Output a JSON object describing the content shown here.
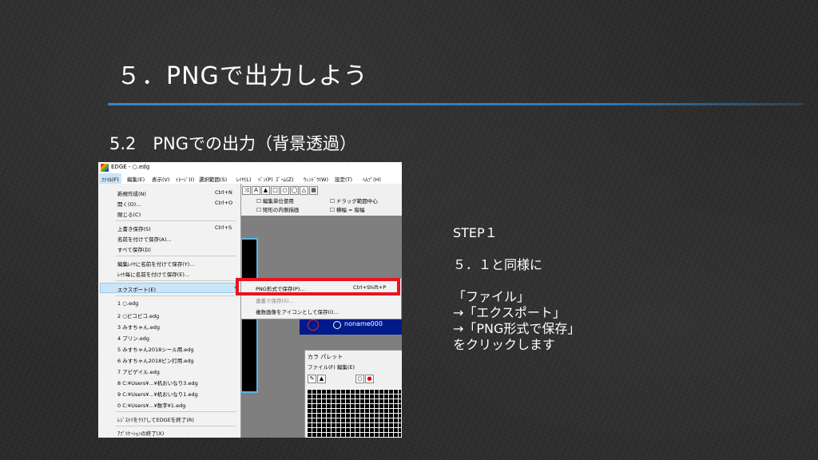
{
  "slide": {
    "title": "５．PNGで出力しよう",
    "subtitle": "5.2　PNGでの出力（背景透過）",
    "step_text": "STEP１\n\n５．１と同様に\n\n「ファイル」\n→「エクスポート」\n→「PNG形式で保存」\nをクリックします"
  },
  "app": {
    "window_title": "EDGE - ○.edg",
    "menus": [
      "ﾌｧｲﾙ(F)",
      "編集(E)",
      "表示(V)",
      "ｲﾒｰｼﾞ(I)",
      "選択範囲(S)",
      "ﾚｲﾔ(L)",
      "ﾍﾟﾝ(P)",
      "ｽﾞｰﾑ(Z)",
      "ｳｨﾝﾄﾞｳ(W)",
      "設定(T)",
      "ﾍﾙﾌﾟ(H)"
    ],
    "toolbar_checks": [
      "編集単位使用",
      "ドラッグ範囲中心",
      "矩形の内側描画",
      "横幅 = 縦幅"
    ],
    "file_menu": [
      {
        "label": "新規作成(N)",
        "key": "Ctrl+N"
      },
      {
        "label": "開く(O)...",
        "key": "Ctrl+O"
      },
      {
        "label": "閉じる(C)",
        "key": ""
      },
      {
        "label": "上書き保存(S)",
        "key": "Ctrl+S"
      },
      {
        "label": "名前を付けて保存(A)...",
        "key": ""
      },
      {
        "label": "すべて保存(D)",
        "key": ""
      },
      {
        "label": "編集ﾚｲﾔに名前を付けて保存(Y)...",
        "key": ""
      },
      {
        "label": "ﾚｲﾔ毎に名前を付けて保存(E)...",
        "key": ""
      },
      {
        "label": "エクスポート(E)",
        "key": ""
      },
      {
        "label": "1 ○.edg",
        "key": ""
      },
      {
        "label": "2 ○ピコピコ.edg",
        "key": ""
      },
      {
        "label": "3 みすちゃん.edg",
        "key": ""
      },
      {
        "label": "4 プリン.edg",
        "key": ""
      },
      {
        "label": "5 みすちゃん2018シール用.edg",
        "key": ""
      },
      {
        "label": "6 みすちゃん2018ピン打用.edg",
        "key": ""
      },
      {
        "label": "7 アピゲイル.edg",
        "key": ""
      },
      {
        "label": "8 C:¥Users¥...¥机おいなり3.edg",
        "key": ""
      },
      {
        "label": "9 C:¥Users¥...¥机おいなり1.edg",
        "key": ""
      },
      {
        "label": "0 C:¥Users¥...¥数字¥1.edg",
        "key": ""
      },
      {
        "label": "ﾚｼﾞｽﾄﾘをｸﾘｱしてEDGEを終了(R)",
        "key": ""
      },
      {
        "label": "ｱﾌﾟﾘｹｰｼｮﾝの終了(X)",
        "key": ""
      }
    ],
    "export_submenu": {
      "png_label": "PNG形式で保存(P)...",
      "png_key": "Ctrl+Shift+P",
      "item2": "連番で保存(S)...",
      "item3": "複数画像をアイコンとして保存(I)..."
    },
    "layer_name": "noname000",
    "palette": {
      "title": "カラ  パレット",
      "menu": "ファイル(F)  編集(E)"
    }
  }
}
